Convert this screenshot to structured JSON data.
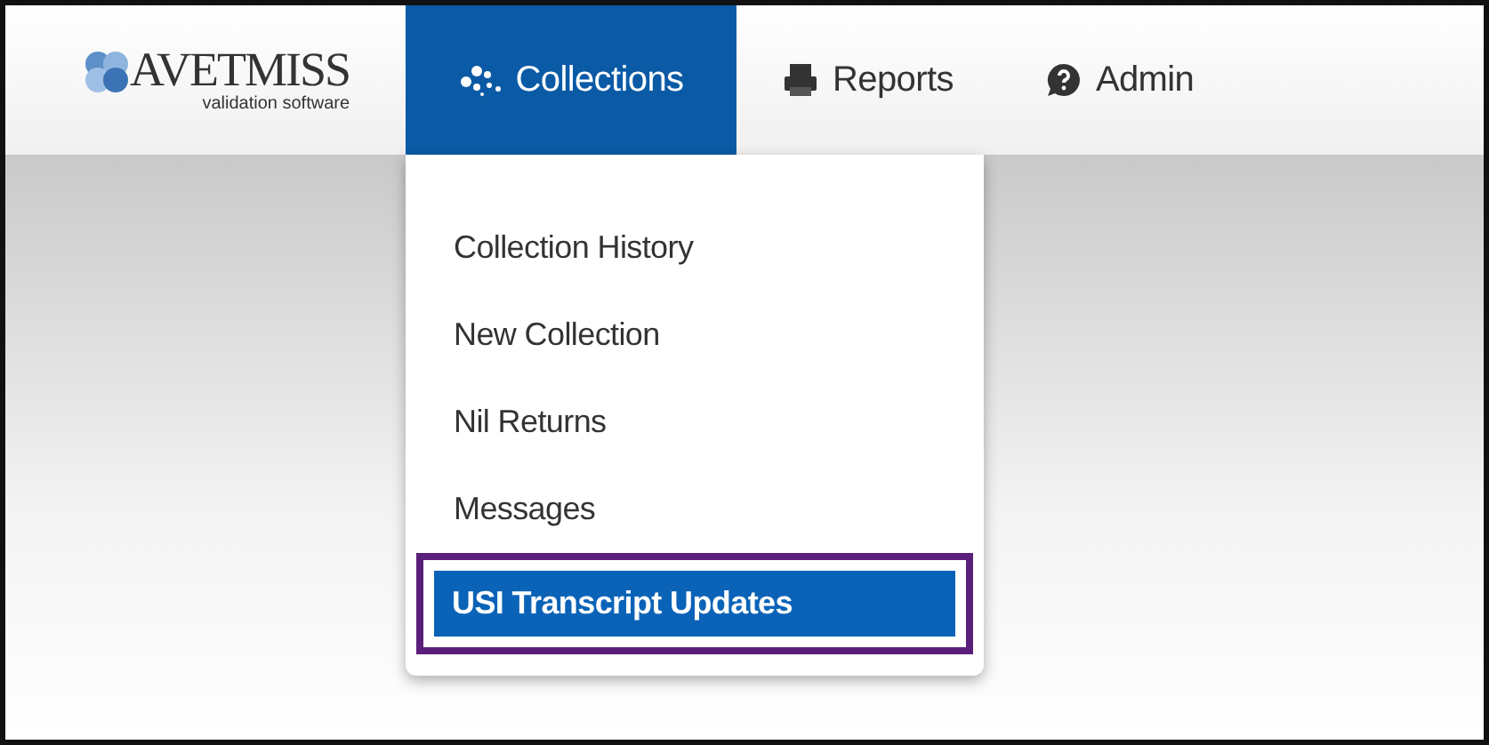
{
  "logo": {
    "name": "AVETMISS",
    "tagline": "validation software"
  },
  "nav": [
    {
      "label": "Collections",
      "selected": true
    },
    {
      "label": "Reports",
      "selected": false
    },
    {
      "label": "Admin",
      "selected": false
    }
  ],
  "menu": {
    "items": [
      {
        "label": "Collection History",
        "selected": false,
        "outlined": false
      },
      {
        "label": "New Collection",
        "selected": false,
        "outlined": false
      },
      {
        "label": "Nil Returns",
        "selected": false,
        "outlined": false
      },
      {
        "label": "Messages",
        "selected": false,
        "outlined": false
      },
      {
        "label": "USI Transcript Updates",
        "selected": true,
        "outlined": true
      }
    ]
  }
}
